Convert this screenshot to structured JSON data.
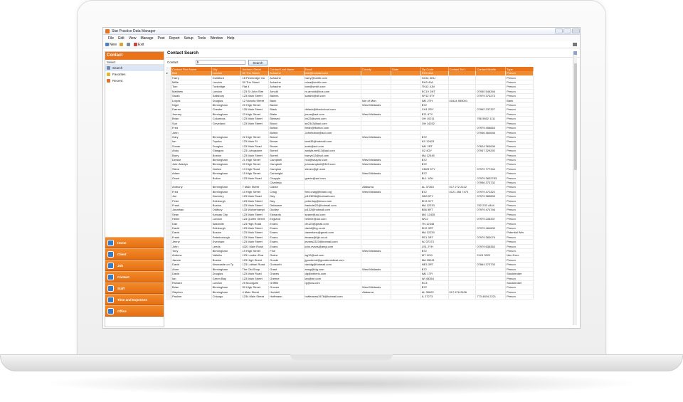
{
  "window": {
    "title": "Star Practice Data Manager"
  },
  "menu": [
    "File",
    "Edit",
    "View",
    "Manage",
    "Post",
    "Report",
    "Setup",
    "Tools",
    "Window",
    "Help"
  ],
  "toolbar": {
    "new_label": "New",
    "exit_label": "Exit"
  },
  "sidebar": {
    "header": "Contact",
    "select_label": "Select",
    "items": [
      {
        "label": "Search",
        "icon": "magnifier-icon"
      },
      {
        "label": "Favorites",
        "icon": "star-icon"
      },
      {
        "label": "Recent",
        "icon": "clock-icon"
      }
    ],
    "nav": [
      "Home",
      "Client",
      "Job",
      "Contact",
      "Staff",
      "Time and Expenses",
      "Office"
    ]
  },
  "main": {
    "title": "Contact Search",
    "search_label": "Contact",
    "search_value": "b",
    "search_button": "Search"
  },
  "table": {
    "columns": [
      "Contact First Name",
      "City",
      "Address Street",
      "Contact Last Name",
      "Email",
      "County",
      "State",
      "Zip Code",
      "Contact Tel 1",
      "Contact Mobile",
      "Type"
    ],
    "rows": [
      [
        "Bob",
        "London",
        "50 The Street",
        "Achache",
        "bob@hotmail.com",
        "",
        "",
        "RH3 4JA",
        "",
        "",
        "Person"
      ],
      [
        "Harry",
        "Guildford",
        "18 Pembridge Ga",
        "Achache",
        "harry@smith.com",
        "",
        "",
        "GU11 4DU",
        "",
        "",
        "Person"
      ],
      [
        "Millie",
        "London",
        "50 The Street",
        "Achache",
        "mina@smith.com",
        "",
        "",
        "RH3 4JA",
        "",
        "",
        "Person"
      ],
      [
        "Tom",
        "Tunbridge",
        "Flat 4",
        "Achache",
        "tom@smith.com",
        "",
        "",
        "TN12 4JN",
        "",
        "",
        "Person"
      ],
      [
        "Matthew",
        "London",
        "123 St John Stre",
        "Arnold",
        "m.arnold@bos.com",
        "",
        "",
        "EC1V 2NT",
        "",
        "07930 546346",
        "Person"
      ],
      [
        "Sarah",
        "Salisbury",
        "123 Main Street",
        "Baines",
        "sarahb@dll.com",
        "",
        "",
        "SP12 5TY",
        "",
        "07979 373273",
        "Person"
      ],
      [
        "Lloyds",
        "Douglas",
        "12 Victoria Street",
        "Bank",
        "",
        "Isle of Man",
        "",
        "IM2 2TH",
        "01624 555001",
        "",
        "Bank"
      ],
      [
        "Nigel",
        "Birmingham",
        "20 High Street",
        "Baxter",
        "",
        "West Midlands",
        "",
        "B72",
        "",
        "",
        "Person"
      ],
      [
        "Darren",
        "Chester",
        "125 Main Street",
        "Black",
        "dblack@blackcloud.com",
        "",
        "",
        "CH1 2RY",
        "",
        "07962 237327",
        "Person"
      ],
      [
        "Jeremy",
        "Birmingham",
        "23 High Street",
        "Blake",
        "jezza@aol.com",
        "West Midlands",
        "",
        "B71 6TY",
        "",
        "",
        "Person"
      ],
      [
        "Brian",
        "Columbus",
        "123 Main Street",
        "Blessed",
        "bb22@work.com",
        "",
        "",
        "OH 10211",
        "",
        "786 5652 1111",
        "Person"
      ],
      [
        "Sue",
        "Cleveland",
        "123 Main Street",
        "Blood",
        "sb2343@aol.com",
        "",
        "",
        "OH 14252",
        "",
        "",
        "Person"
      ],
      [
        "Fred",
        "",
        "",
        "Bolton",
        "fredb@fbolton.com",
        "",
        "",
        "",
        "",
        "07979 456663",
        "Person"
      ],
      [
        "John",
        "",
        "",
        "Bolton",
        "Johnbolton@aol.com",
        "",
        "",
        "",
        "",
        "07946 464646",
        "Person"
      ],
      [
        "Gary",
        "Birmingham",
        "22 High Street",
        "Brand",
        "",
        "West Midlands",
        "",
        "B72",
        "",
        "",
        "Person"
      ],
      [
        "Ian",
        "Topeka",
        "123 Main St",
        "Brown",
        "ianb35@hotmail.com",
        "",
        "",
        "KS 12623",
        "",
        "",
        "Person"
      ],
      [
        "Susan",
        "Douglas",
        "123 Main Road",
        "Brown",
        "susb@aol.com",
        "",
        "",
        "IM1 2RT",
        "",
        "07624 363636",
        "Person"
      ],
      [
        "Andy",
        "Glasgow",
        "123 Livingstone",
        "Burrell",
        "andyburrell12@aol.com",
        "",
        "",
        "G2 4GY",
        "",
        "07937 329292",
        "Person"
      ],
      [
        "Barry",
        "Boston",
        "123 Main Street",
        "Burrell",
        "barryb12@aol.com",
        "",
        "",
        "MA 12345",
        "",
        "",
        "Person"
      ],
      [
        "Denise",
        "Birmingham",
        "21 High Street",
        "Campbell",
        "hcd@shaptic.com",
        "West Midlands",
        "",
        "B72",
        "",
        "",
        "Person"
      ],
      [
        "John Martyn",
        "Birmingham",
        "20 High Street",
        "Campbell",
        "johncampbell@343.com",
        "West Midlands",
        "",
        "B72",
        "",
        "",
        "Person"
      ],
      [
        "Steve",
        "Harlow",
        "13 High Road",
        "Campion",
        "stevec@gh.com",
        "",
        "",
        "CM23 5TY",
        "",
        "07979 777344",
        "Person"
      ],
      [
        "Adam",
        "Birmingham",
        "15 High Street",
        "Cartwright",
        "",
        "West Midlands",
        "",
        "B72",
        "",
        "",
        "Person"
      ],
      [
        "Grant",
        "Bolton",
        "123 Main Road",
        "Chapple",
        "grantc@aol.com",
        "",
        "",
        "BL1 1GH",
        "",
        "07979 3832783",
        "Person"
      ],
      [
        "",
        "",
        "",
        "Charlesic",
        "",
        "",
        "",
        "",
        "",
        "07956 373732",
        "Person"
      ],
      [
        "Anthony",
        "Birmingham",
        "7 Main Street",
        "Clarke",
        "",
        "Alabama",
        "",
        "AL 37363",
        "017 272 2222",
        "",
        "Person"
      ],
      [
        "Fred",
        "Birmingham",
        "10 High Street",
        "Craig",
        "fred.craig@fdrain.org",
        "West Midlands",
        "",
        "B72",
        "0121 355 7474",
        "07979 472322",
        "Person"
      ],
      [
        "Jon",
        "Daventry",
        "123 Main Road",
        "Day",
        "jd193256@hotmail.com",
        "",
        "",
        "NN3 5TY",
        "",
        "07979 383833",
        "Person"
      ],
      [
        "Peter",
        "Edinburgh",
        "123 Main Street",
        "Day",
        "peterday@tesco.com",
        "",
        "",
        "EH3 3YT",
        "",
        "",
        "Person"
      ],
      [
        "Frank",
        "Boston",
        "123 Main Street",
        "Delaware",
        "frankdel22@hotmail.com",
        "",
        "",
        "MA 12233",
        "",
        "782 233 4444",
        "Person"
      ],
      [
        "Jonathan",
        "Oldbury",
        "133 Wolverhampt",
        "Dudley",
        "jd132@hotmail.com",
        "",
        "",
        "B56 5RT",
        "",
        "07979 474746",
        "Person"
      ],
      [
        "Sean",
        "Kansas City",
        "123 Main Street",
        "Edwards",
        "seane@aol.com",
        "",
        "",
        "MO 12435",
        "",
        "",
        "Person"
      ],
      [
        "Helen",
        "London",
        "123 Queen Street",
        "England",
        "helene@aol.com",
        "",
        "",
        "WC2",
        "",
        "07979 236337",
        "Person"
      ],
      [
        "Dan",
        "Nashville",
        "123 High Road",
        "Evans",
        "de123@gmail.com",
        "",
        "",
        "TN 12345",
        "",
        "",
        "Person"
      ],
      [
        "David",
        "Edinburgh",
        "123 Main Street",
        "Evans",
        "david@hg.co.uk",
        "",
        "",
        "EH2 3RT",
        "",
        "07979 464600",
        "Person"
      ],
      [
        "David",
        "Boston",
        "123 Main Street",
        "Evans",
        "daveelans@gmail.com",
        "",
        "",
        "MA 12233",
        "",
        "",
        "Potential Wtn"
      ],
      [
        "Frank",
        "Peterborough",
        "123 Main Street",
        "Evans",
        "fevans@hjb.co.uk",
        "",
        "",
        "PE1 3RT",
        "",
        "07979 383076",
        "Person"
      ],
      [
        "Jenny",
        "Evesham",
        "123 Main Street",
        "Evans",
        "jevans2323@hotmail.com",
        "",
        "",
        "NJ 37373",
        "",
        "",
        "Person"
      ],
      [
        "John",
        "Leeds",
        "4321 Main Road",
        "Evans",
        "john.evans@aegl.com",
        "",
        "",
        "LS1 2YH",
        "",
        "07979 636363",
        "Person"
      ],
      [
        "Tony",
        "Birmingham",
        "19 High Street",
        "Fine",
        "",
        "West Midlands",
        "",
        "B72",
        "",
        "",
        "Person"
      ],
      [
        "Andrew",
        "Valletta",
        "123 London Roa",
        "Galea",
        "ag12@aol.com",
        "",
        "",
        "MT 1211",
        "",
        "2124 3222",
        "Non Exec"
      ],
      [
        "James",
        "Boston",
        "123 High Street",
        "Goode",
        "jgoodemd@goodemedical.com",
        "",
        "",
        "MA 35241",
        "",
        "",
        "Person"
      ],
      [
        "David",
        "Newcastle on Ty",
        "123 Lothian Road",
        "Godsorth",
        "davidg@hotmail.com",
        "",
        "",
        "NE3 3RT",
        "",
        "07864 373733",
        "Person"
      ],
      [
        "Anne",
        "Birmingham",
        "The Old Shop",
        "Grant",
        "anng@ldg.com",
        "West Midlands",
        "",
        "B72",
        "",
        "",
        "Person"
      ],
      [
        "David",
        "Douglas",
        "123 Main Road",
        "Graves",
        "dg@wtheric.com",
        "",
        "",
        "IM1 1TR",
        "",
        "",
        "Stockbroker"
      ],
      [
        "Ian",
        "Green Bay",
        "123 Main Street",
        "Greene",
        "ian@be.com",
        "",
        "",
        "WI 45354",
        "",
        "",
        "Person"
      ],
      [
        "Richard",
        "London",
        "25 Moorgate",
        "Griffith",
        "rg@ow.com",
        "",
        "",
        "EC3",
        "",
        "",
        "Stockbroker"
      ],
      [
        "Brian",
        "Birmingham",
        "50 High Street",
        "Groves",
        "",
        "West Midlands",
        "",
        "B72",
        "",
        "",
        "Person"
      ],
      [
        "Stephen",
        "Birmingham",
        "4 Main Street",
        "Hoddell",
        "",
        "Alabama",
        "",
        "AL 35622",
        "017 676 2626",
        "",
        "Person"
      ],
      [
        "Pauline",
        "Chicago",
        "1234 Main Street",
        "Hoffmann",
        "hoffmanns3478@hotmail.com",
        "",
        "",
        "IL 27273",
        "",
        "773 4834 2221",
        "Person"
      ]
    ]
  },
  "colors": {
    "accent": "#e8731a",
    "selection": "#f08a2e"
  }
}
